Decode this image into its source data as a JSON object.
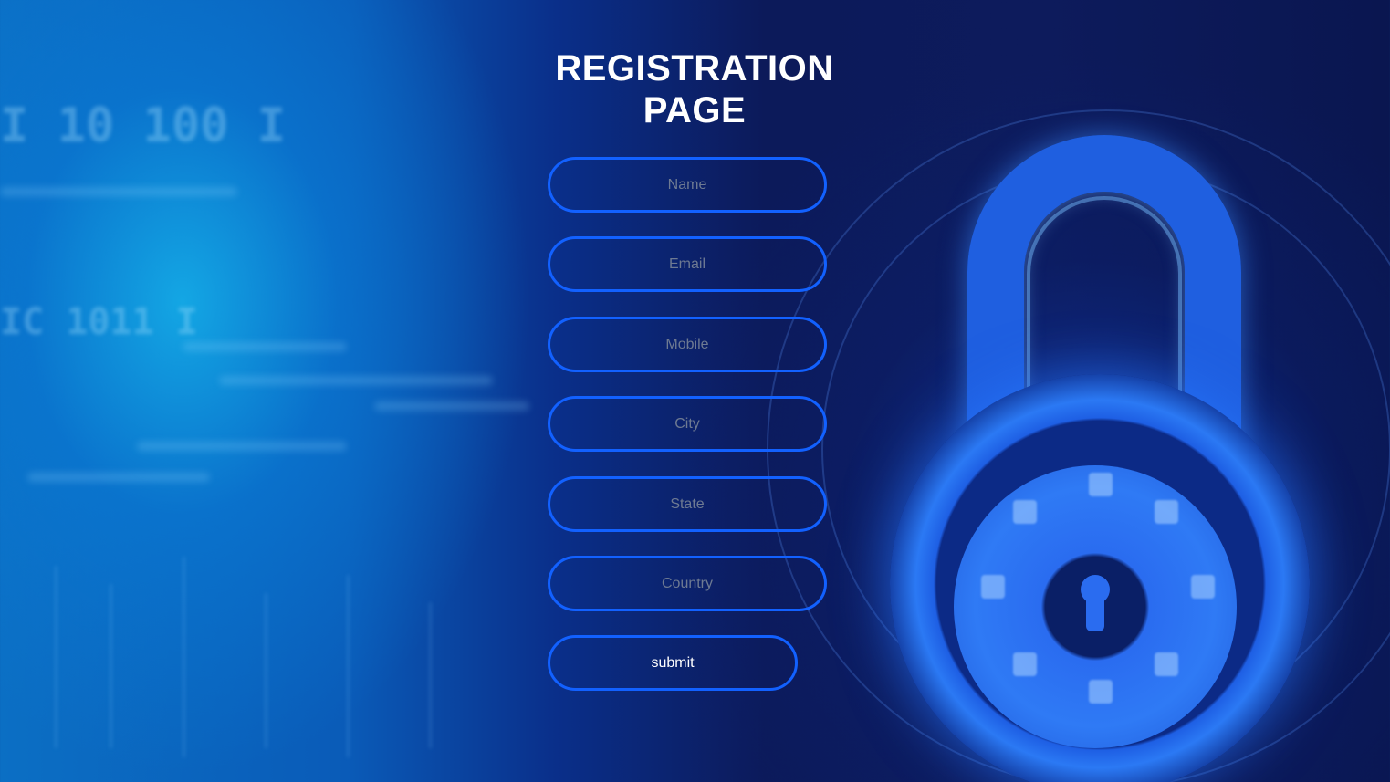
{
  "page": {
    "title": "REGISTRATION PAGE"
  },
  "form": {
    "fields": [
      {
        "key": "name",
        "placeholder": "Name",
        "value": ""
      },
      {
        "key": "email",
        "placeholder": "Email",
        "value": ""
      },
      {
        "key": "mobile",
        "placeholder": "Mobile",
        "value": ""
      },
      {
        "key": "city",
        "placeholder": "City",
        "value": ""
      },
      {
        "key": "state",
        "placeholder": "State",
        "value": ""
      },
      {
        "key": "country",
        "placeholder": "Country",
        "value": ""
      }
    ],
    "submit_label": "submit"
  },
  "background": {
    "image": "padlock-cybersecurity",
    "code_fragments": [
      "I 10 100 I",
      "IC 1011 I"
    ]
  },
  "colors": {
    "field_border": "#1261ff",
    "title_text": "#ffffff",
    "placeholder_text": "#6e7a92",
    "background_dark": "#0d1b5c",
    "background_light": "#0b6fc4"
  }
}
